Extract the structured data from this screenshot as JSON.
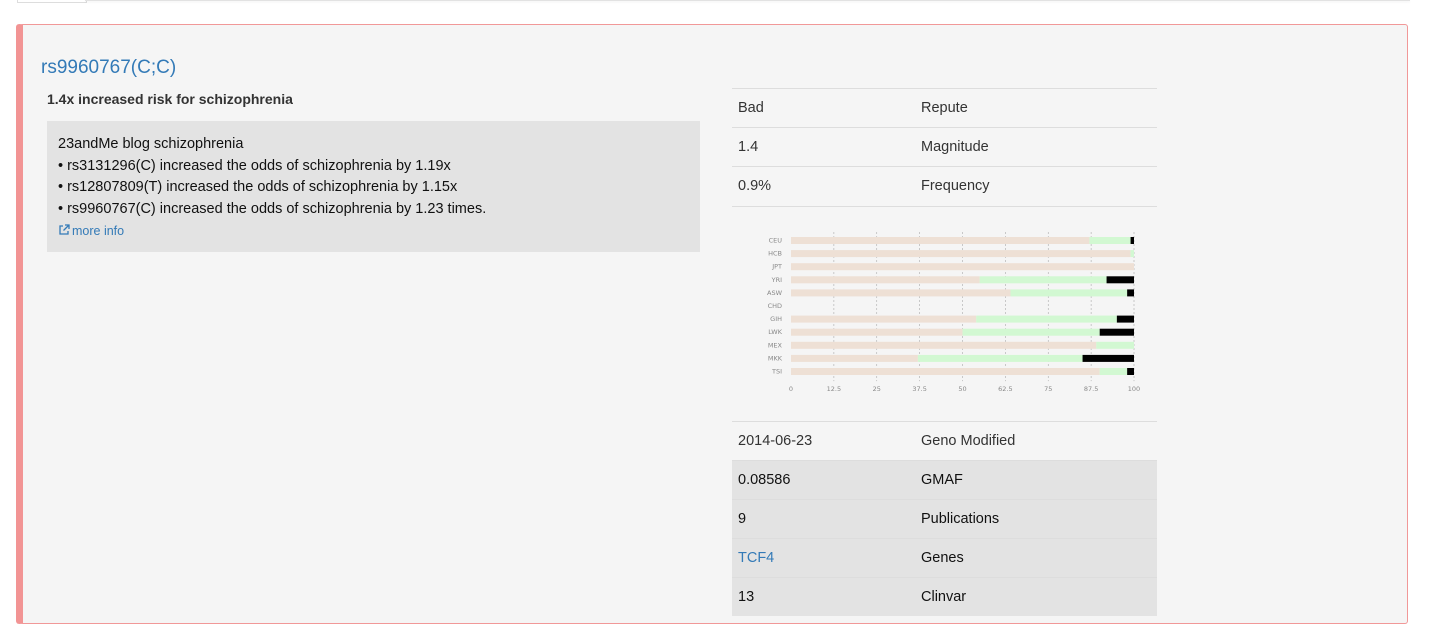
{
  "snp": {
    "title": "rs9960767(C;C)",
    "summary": "1.4x increased risk for schizophrenia"
  },
  "infobox": {
    "lines": [
      "23andMe blog schizophrenia",
      "• rs3131296(C) increased the odds of schizophrenia by 1.19x",
      "• rs12807809(T) increased the odds of schizophrenia by 1.15x",
      "• rs9960767(C) increased the odds of schizophrenia by 1.23 times."
    ],
    "more_info": "more info",
    "more_info_icon": "external-link-icon"
  },
  "attributes_top": [
    {
      "value": "Bad",
      "label": "Repute"
    },
    {
      "value": "1.4",
      "label": "Magnitude"
    },
    {
      "value": "0.9%",
      "label": "Frequency"
    }
  ],
  "attributes_bottom": [
    {
      "value": "2014-06-23",
      "label": "Geno Modified",
      "shaded": false
    },
    {
      "value": "0.08586",
      "label": "GMAF",
      "shaded": true
    },
    {
      "value": "9",
      "label": "Publications",
      "shaded": true
    },
    {
      "value": "TCF4",
      "label": "Genes",
      "shaded": true,
      "link": true
    },
    {
      "value": "13",
      "label": "Clinvar",
      "shaded": true
    }
  ],
  "colors": {
    "panel_border": "#f29494",
    "link": "#337ab7",
    "bar_ref": "#eee0d5",
    "bar_het": "#d2f8d2",
    "bar_alt": "#000000"
  },
  "chart_data": {
    "type": "bar",
    "orientation": "horizontal",
    "stacked": true,
    "categories": [
      "CEU",
      "HCB",
      "JPT",
      "YRI",
      "ASW",
      "CHD",
      "GIH",
      "LWK",
      "MEX",
      "MKK",
      "TSI"
    ],
    "x_ticks": [
      "0",
      "12.5",
      "25",
      "37.5",
      "50",
      "62.5",
      "75",
      "87.5",
      "100"
    ],
    "xlim": [
      0,
      100
    ],
    "grid": "vertical dashed",
    "series": [
      {
        "values": [
          87,
          99,
          100,
          55,
          64,
          0,
          54,
          50,
          89,
          37,
          90
        ]
      },
      {
        "values": [
          12,
          1,
          0,
          37,
          34,
          0,
          41,
          40,
          11,
          48,
          8
        ]
      },
      {
        "values": [
          1,
          0,
          0,
          8,
          2,
          0,
          5,
          10,
          0,
          15,
          2
        ]
      }
    ]
  }
}
